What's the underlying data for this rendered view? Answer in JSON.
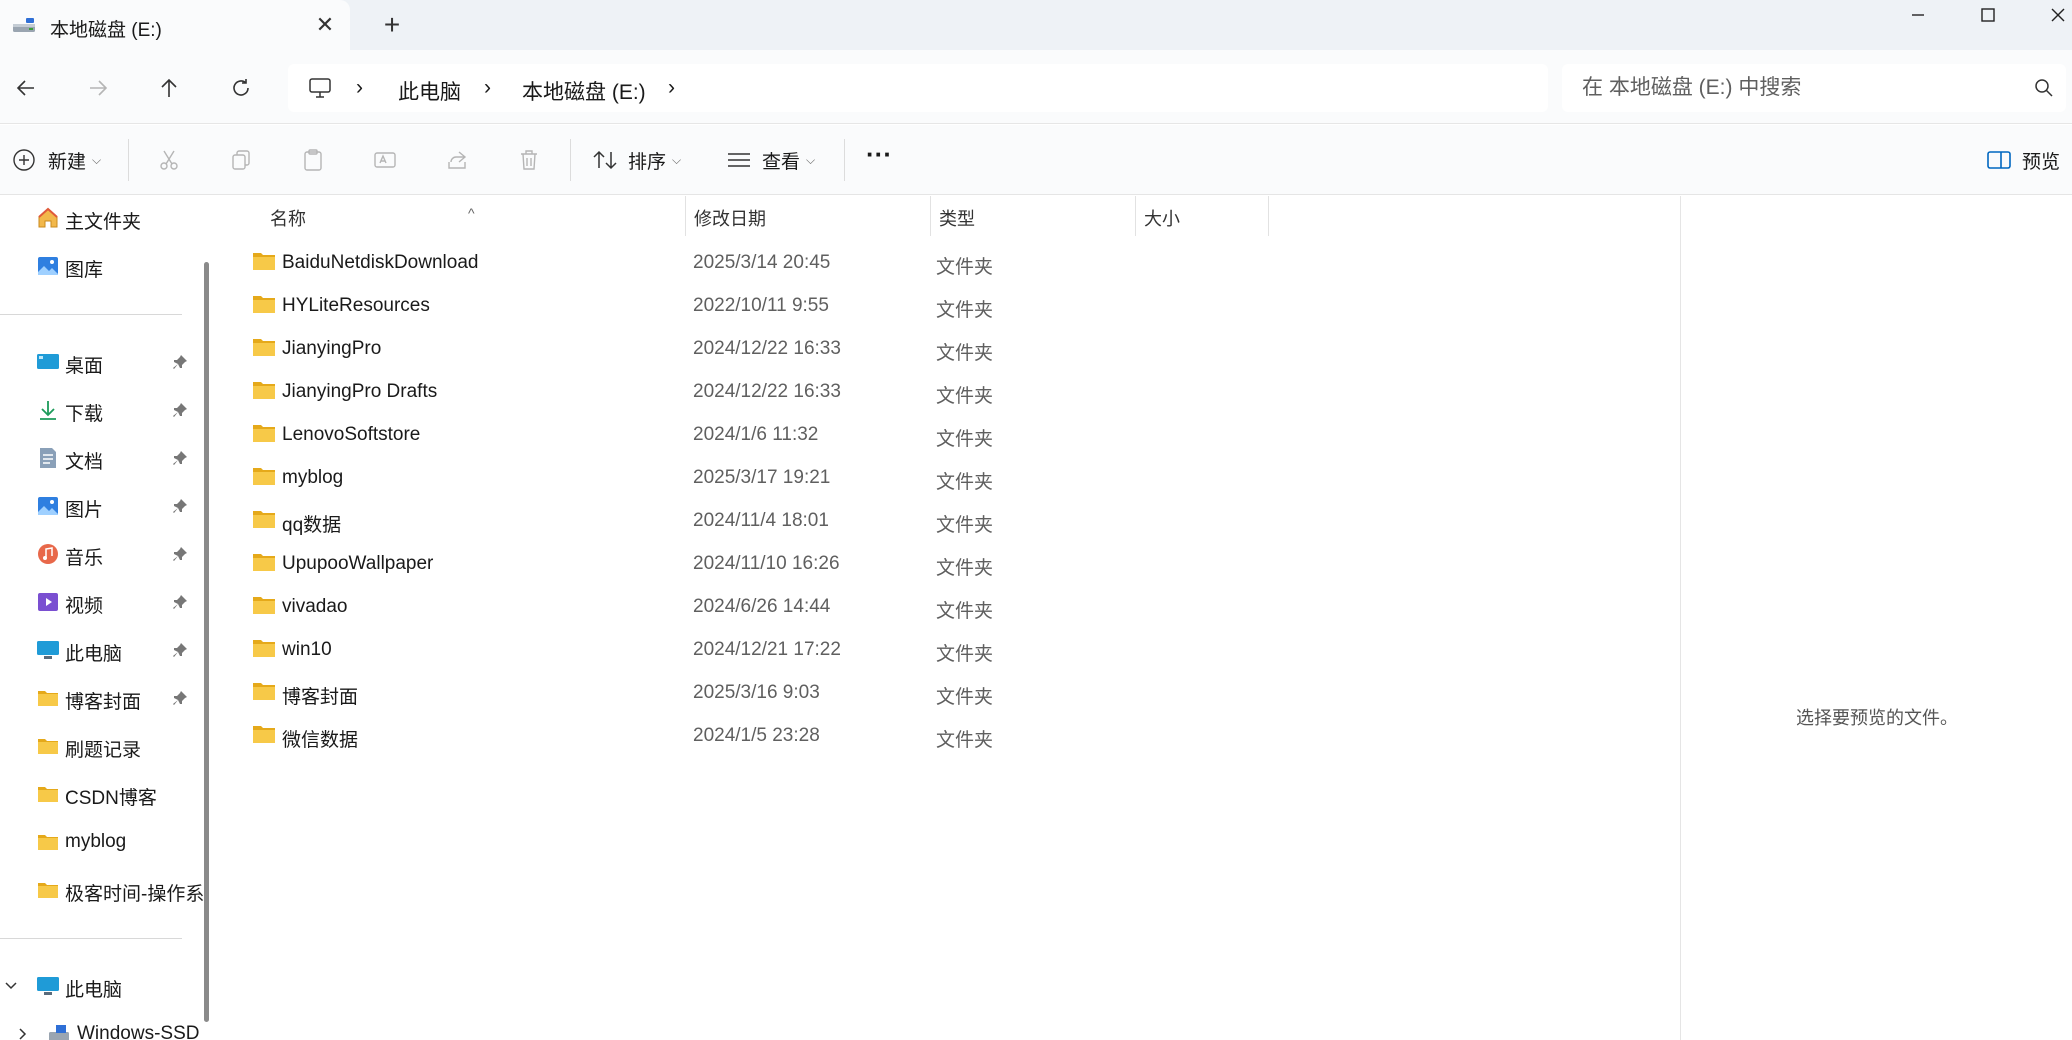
{
  "tab": {
    "title": "本地磁盘 (E:)",
    "close": "✕",
    "new_tab": "+"
  },
  "window": {
    "minimize": "minimize",
    "maximize": "maximize",
    "close": "close"
  },
  "address": {
    "root_icon": "computer-icon",
    "crumbs": [
      "此电脑",
      "本地磁盘 (E:)"
    ],
    "separator": "›"
  },
  "search": {
    "placeholder": "在 本地磁盘 (E:) 中搜索"
  },
  "commands": {
    "new_label": "新建",
    "sort_label": "排序",
    "view_label": "查看",
    "more_label": "···",
    "preview_label": "预览"
  },
  "sidebar": {
    "top_items": [
      {
        "label": "主文件夹",
        "icon": "home-icon"
      },
      {
        "label": "图库",
        "icon": "gallery-icon"
      }
    ],
    "quick_items": [
      {
        "label": "桌面",
        "icon": "desktop-icon",
        "pinned": true
      },
      {
        "label": "下载",
        "icon": "download-icon",
        "pinned": true
      },
      {
        "label": "文档",
        "icon": "documents-icon",
        "pinned": true
      },
      {
        "label": "图片",
        "icon": "pictures-icon",
        "pinned": true
      },
      {
        "label": "音乐",
        "icon": "music-icon",
        "pinned": true
      },
      {
        "label": "视频",
        "icon": "videos-icon",
        "pinned": true
      },
      {
        "label": "此电脑",
        "icon": "computer-icon",
        "pinned": true
      },
      {
        "label": "博客封面",
        "icon": "folder-icon",
        "pinned": true
      },
      {
        "label": "刷题记录",
        "icon": "folder-icon",
        "pinned": false
      },
      {
        "label": "CSDN博客",
        "icon": "folder-icon",
        "pinned": false
      },
      {
        "label": "myblog",
        "icon": "folder-icon",
        "pinned": false
      },
      {
        "label": "极客时间-操作系",
        "icon": "folder-icon",
        "pinned": false
      }
    ],
    "tree": [
      {
        "label": "此电脑",
        "icon": "computer-icon",
        "expanded": true
      },
      {
        "label": "Windows-SSD",
        "icon": "drive-icon",
        "expanded": false
      }
    ]
  },
  "columns": {
    "name": "名称",
    "date": "修改日期",
    "type": "类型",
    "size": "大小"
  },
  "files": [
    {
      "name": "BaiduNetdiskDownload",
      "date": "2025/3/14 20:45",
      "type": "文件夹"
    },
    {
      "name": "HYLiteResources",
      "date": "2022/10/11 9:55",
      "type": "文件夹"
    },
    {
      "name": "JianyingPro",
      "date": "2024/12/22 16:33",
      "type": "文件夹"
    },
    {
      "name": "JianyingPro Drafts",
      "date": "2024/12/22 16:33",
      "type": "文件夹"
    },
    {
      "name": "LenovoSoftstore",
      "date": "2024/1/6 11:32",
      "type": "文件夹"
    },
    {
      "name": "myblog",
      "date": "2025/3/17 19:21",
      "type": "文件夹"
    },
    {
      "name": "qq数据",
      "date": "2024/11/4 18:01",
      "type": "文件夹"
    },
    {
      "name": "UpupooWallpaper",
      "date": "2024/11/10 16:26",
      "type": "文件夹"
    },
    {
      "name": "vivadao",
      "date": "2024/6/26 14:44",
      "type": "文件夹"
    },
    {
      "name": "win10",
      "date": "2024/12/21 17:22",
      "type": "文件夹"
    },
    {
      "name": "博客封面",
      "date": "2025/3/16 9:03",
      "type": "文件夹"
    },
    {
      "name": "微信数据",
      "date": "2024/1/5 23:28",
      "type": "文件夹"
    }
  ],
  "preview": {
    "empty_text": "选择要预览的文件。"
  },
  "colors": {
    "folder": "#f7c948",
    "folder_dark": "#e5a91a",
    "accent": "#0067c0"
  }
}
